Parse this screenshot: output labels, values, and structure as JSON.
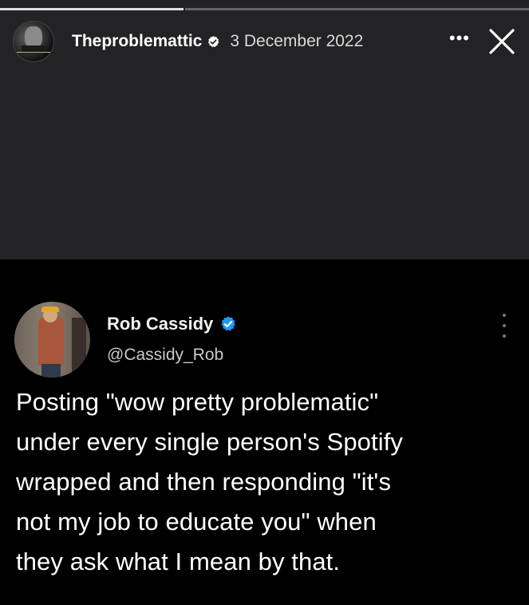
{
  "story": {
    "username": "Theproblemattic",
    "date": "3 December 2022",
    "more_label": "•••",
    "close_icon": "close-icon",
    "verified_icon": "verified-badge-icon"
  },
  "tweet": {
    "name": "Rob Cassidy",
    "handle": "@Cassidy_Rob",
    "verified_color": "#1D9BF0",
    "lines": [
      "Posting \"wow pretty problematic\"",
      "under every single person's Spotify",
      "wrapped and then responding \"it's",
      "not my job to educate you\" when",
      "they ask what I mean by that."
    ]
  },
  "colors": {
    "story_background": "#232325",
    "tweet_background": "#000000"
  }
}
